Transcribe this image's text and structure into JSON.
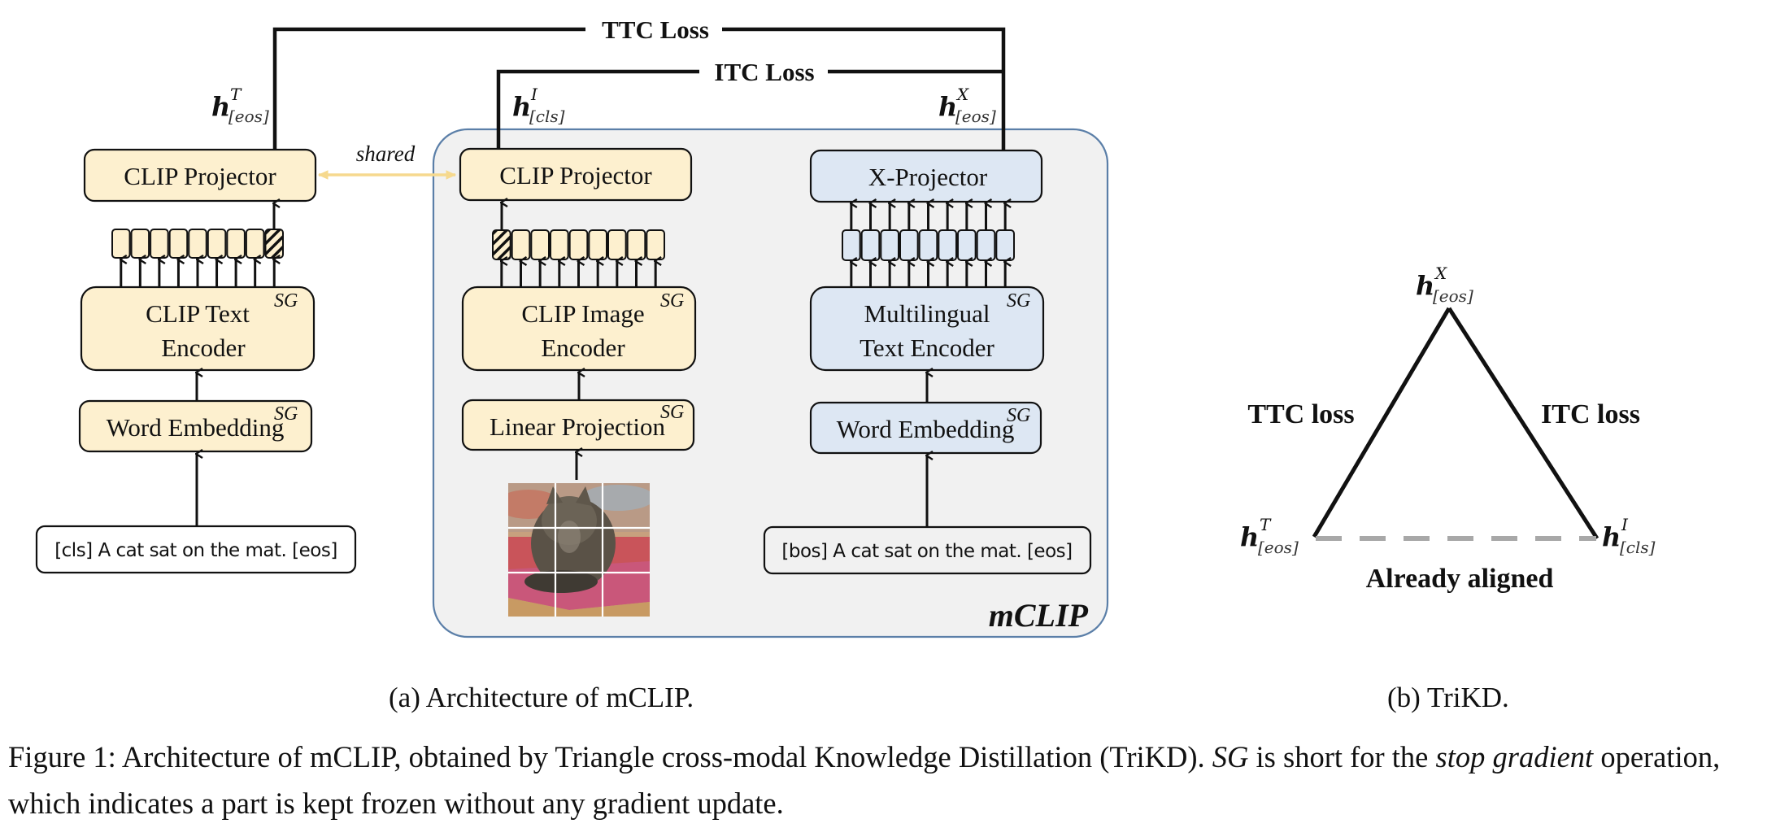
{
  "colors": {
    "clip_fill": "#fdf0cf",
    "x_fill": "#dde7f3",
    "mclip_bg": "#f1f1f1",
    "mclip_border": "#5b7fa8",
    "shared_arrow": "#f6d98e",
    "dashed": "#a8a8a8",
    "stroke": "#111111"
  },
  "losses": {
    "ttc": "TTC Loss",
    "itc": "ITC Loss"
  },
  "h_labels": {
    "text_eos": {
      "base": "h",
      "sup": "T",
      "sub": "[eos]"
    },
    "image_cls": {
      "base": "h",
      "sup": "I",
      "sub": "[cls]"
    },
    "x_eos": {
      "base": "h",
      "sup": "X",
      "sub": "[eos]"
    }
  },
  "shared_label": "shared",
  "sg_tag": "SG",
  "text_branch": {
    "projector": "CLIP Projector",
    "encoder_line1": "CLIP Text",
    "encoder_line2": "Encoder",
    "embedding": "Word Embedding",
    "input": "[cls] A cat sat on the mat. [eos]",
    "token_count": 9,
    "special_token_position": "last"
  },
  "image_branch": {
    "projector": "CLIP Projector",
    "encoder_line1": "CLIP Image",
    "encoder_line2": "Encoder",
    "embedding": "Linear Projection",
    "input_image": "cat-on-mat-photo (3x3 patches)",
    "token_count": 9,
    "special_token_position": "first"
  },
  "x_branch": {
    "projector": "X-Projector",
    "encoder_line1": "Multilingual",
    "encoder_line2": "Text Encoder",
    "embedding": "Word Embedding",
    "input": "[bos] A cat sat on the mat. [eos]",
    "token_count": 9
  },
  "mclip_label": "mCLIP",
  "trikd": {
    "left_edge_label": "TTC loss",
    "right_edge_label": "ITC loss",
    "bottom_edge_label": "Already aligned"
  },
  "captions": {
    "a": "(a) Architecture of mCLIP.",
    "b": "(b) TriKD.",
    "figure_prefix": "Figure 1: Architecture of mCLIP, obtained by Triangle cross-modal Knowledge Distillation (TriKD). ",
    "figure_sg": "SG",
    "figure_mid": " is short for the ",
    "figure_italic": "stop gradient",
    "figure_suffix": " operation, which indicates a part is kept frozen without any gradient update."
  }
}
